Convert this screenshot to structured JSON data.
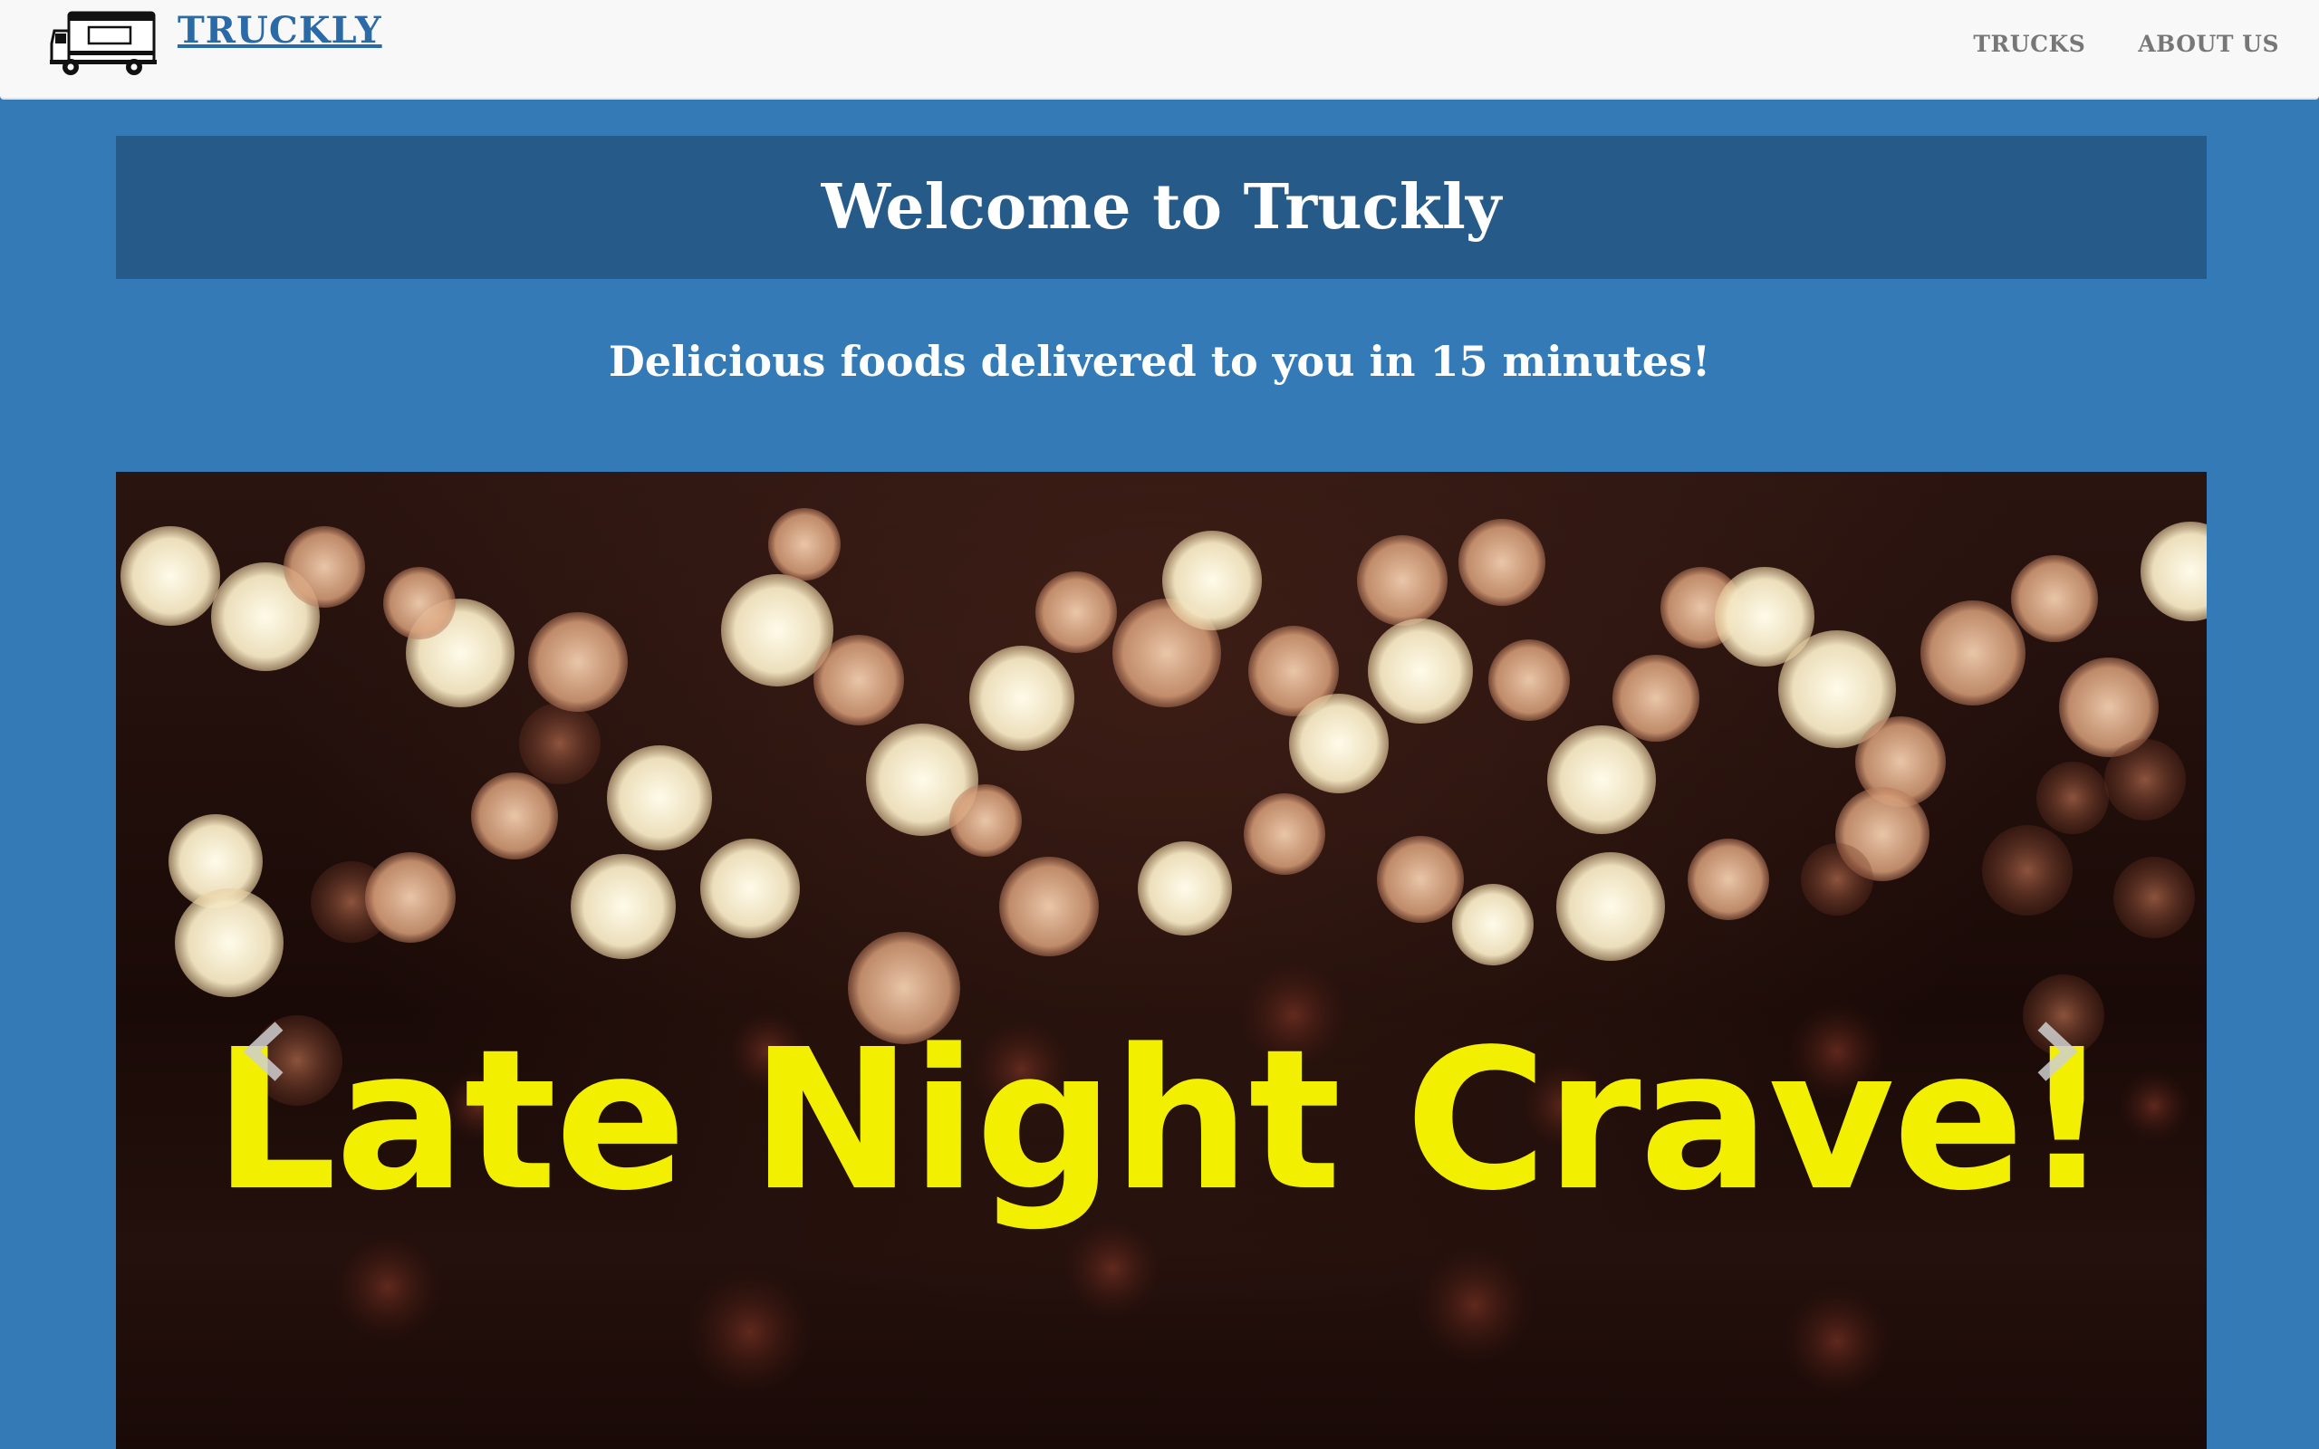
{
  "navbar": {
    "brand": "TRUCKLY",
    "logo_icon": "food-truck-icon",
    "links": [
      {
        "label": "TRUCKS"
      },
      {
        "label": "ABOUT US"
      }
    ]
  },
  "hero": {
    "title": "Welcome to Truckly",
    "tagline": "Delicious foods delivered to you in 15 minutes!"
  },
  "carousel": {
    "caption": "Late Night Crave!",
    "prev_icon": "chevron-left-icon",
    "next_icon": "chevron-right-icon"
  },
  "colors": {
    "page_background": "#337ab7",
    "banner_background": "#265a88",
    "navbar_background": "#f8f8f8",
    "brand_link": "#2a6aa6",
    "caption_yellow": "#f2f000"
  }
}
